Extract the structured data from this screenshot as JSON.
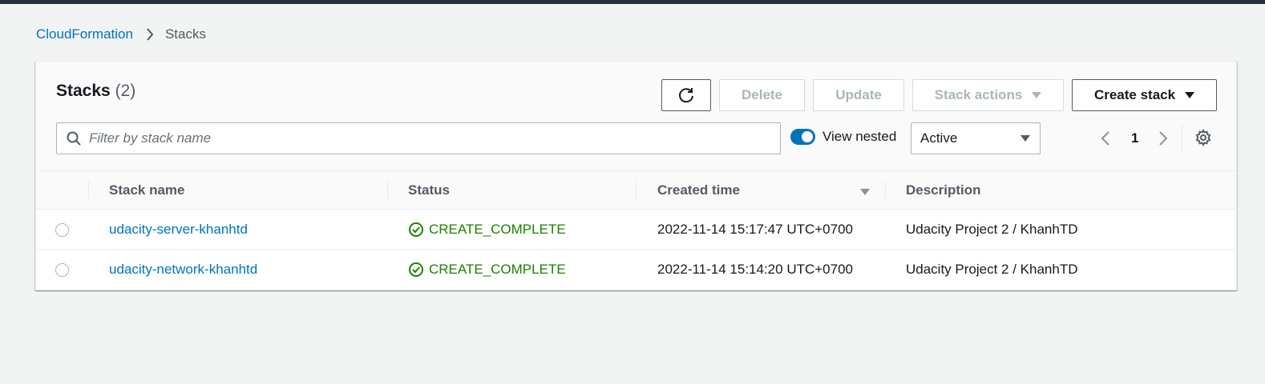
{
  "breadcrumb": {
    "parent": "CloudFormation",
    "current": "Stacks"
  },
  "header": {
    "title": "Stacks",
    "count": "(2)"
  },
  "toolbar": {
    "refresh_icon": "refresh-icon",
    "delete_label": "Delete",
    "update_label": "Update",
    "stack_actions_label": "Stack actions",
    "create_stack_label": "Create stack"
  },
  "filter": {
    "placeholder": "Filter by stack name",
    "value": ""
  },
  "view_nested": {
    "label": "View nested",
    "enabled": true
  },
  "status_filter": {
    "selected": "Active"
  },
  "pagination": {
    "current_page": "1"
  },
  "table": {
    "columns": [
      "Stack name",
      "Status",
      "Created time",
      "Description"
    ],
    "rows": [
      {
        "name": "udacity-server-khanhtd",
        "status": "CREATE_COMPLETE",
        "created": "2022-11-14 15:17:47 UTC+0700",
        "description": "Udacity Project 2 / KhanhTD"
      },
      {
        "name": "udacity-network-khanhtd",
        "status": "CREATE_COMPLETE",
        "created": "2022-11-14 15:14:20 UTC+0700",
        "description": "Udacity Project 2 / KhanhTD"
      }
    ]
  },
  "colors": {
    "link": "#0073bb",
    "success": "#1d8102",
    "topbar": "#232f3e",
    "background": "#f2f3f3"
  }
}
